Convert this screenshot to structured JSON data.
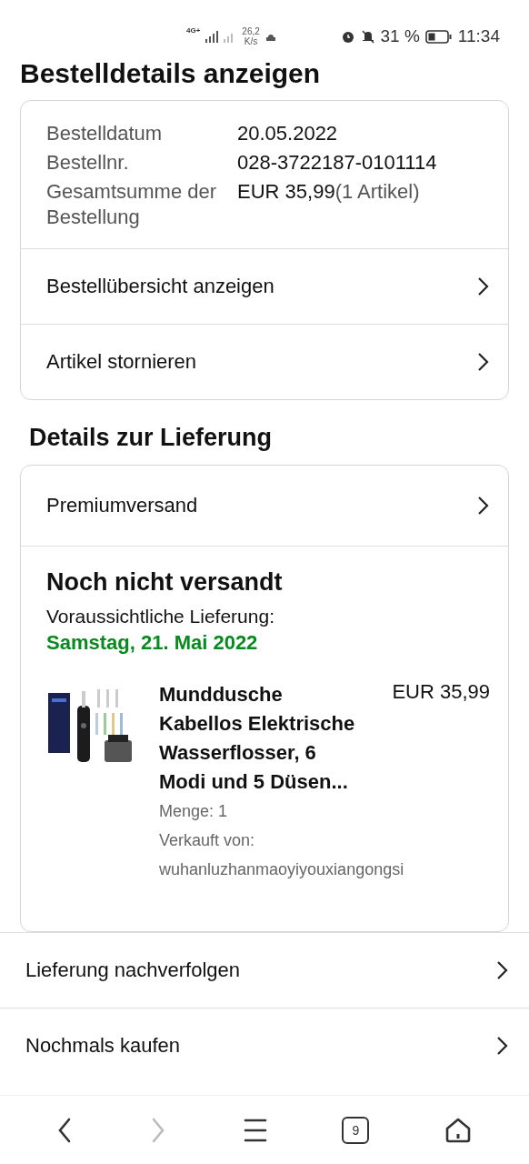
{
  "status_bar": {
    "network": "4G+",
    "speed": "26,2",
    "speed_unit": "K/s",
    "battery": "31 %",
    "time": "11:34"
  },
  "page_title": "Bestelldetails anzeigen",
  "order_info": [
    {
      "label": "Bestelldatum",
      "value": "20.05.2022"
    },
    {
      "label": "Bestellnr.",
      "value": "028-3722187-0101114"
    },
    {
      "label": "Gesamtsumme der Bestellung",
      "value": "EUR 35,99",
      "note": "(1 Artikel)"
    }
  ],
  "order_links": [
    "Bestellübersicht anzeigen",
    "Artikel stornieren"
  ],
  "delivery_heading": "Details zur Lieferung",
  "shipping_method": "Premiumversand",
  "shipment": {
    "status": "Noch nicht versandt",
    "eta_label": "Voraussichtliche Lieferung:",
    "eta_date": "Samstag, 21. Mai 2022",
    "item": {
      "kind": "picture",
      "title": "Munddusche Kabellos Elektrische Wasserflosser, 6 Modi und 5 Düsen...",
      "price": "EUR 35,99",
      "quantity": "Menge: 1",
      "seller_label": "Verkauft von:",
      "seller": "wuhanluzhanmaoyiyouxiangongsi"
    }
  },
  "actions": [
    "Lieferung nachverfolgen",
    "Nochmals kaufen"
  ],
  "bottom_nav": [
    {
      "kind": "back",
      "disabled": false
    },
    {
      "kind": "forward",
      "disabled": true
    },
    {
      "kind": "menu",
      "disabled": false
    },
    {
      "kind": "tabs",
      "label": "9",
      "disabled": false
    },
    {
      "kind": "home",
      "disabled": false
    }
  ]
}
